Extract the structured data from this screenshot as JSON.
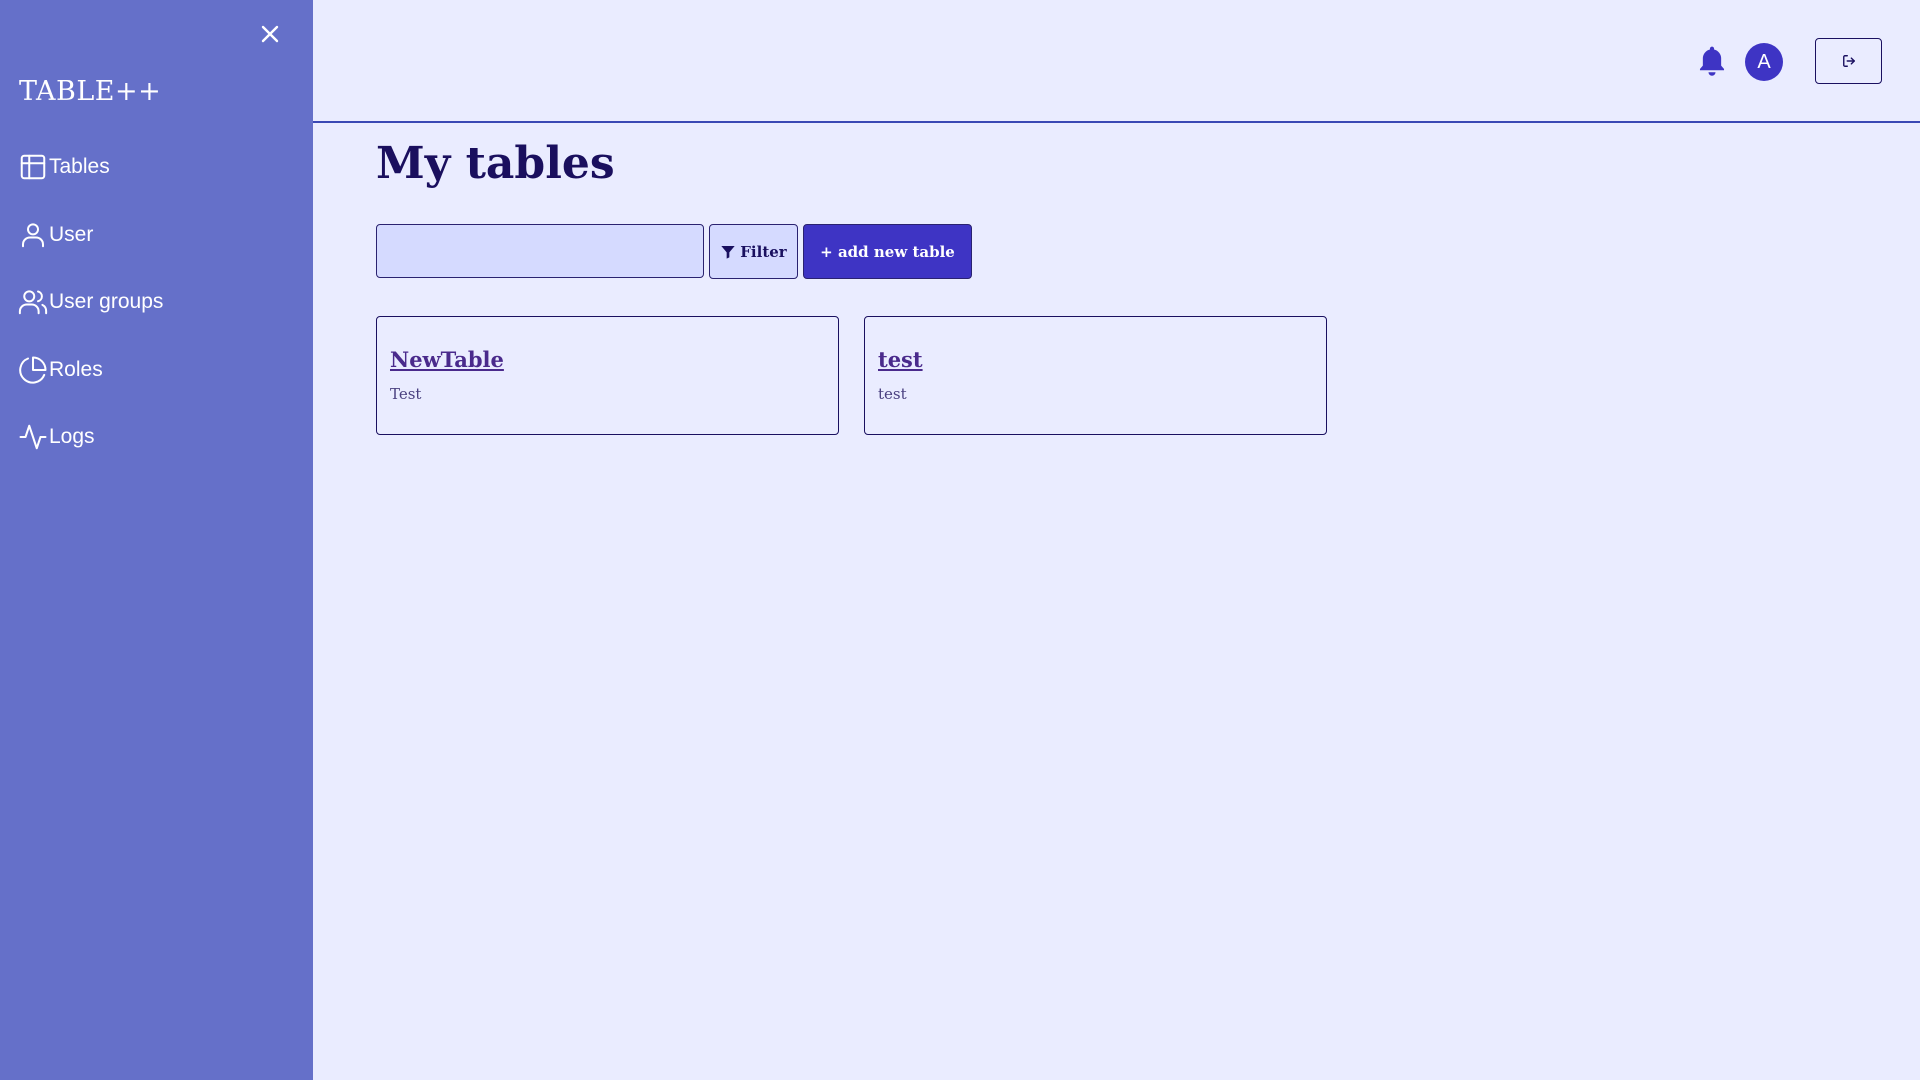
{
  "brand": {
    "name": "TABLE++"
  },
  "sidebar": {
    "close_icon": "close-icon",
    "items": [
      {
        "label": "Tables",
        "icon": "table-icon"
      },
      {
        "label": "User",
        "icon": "user-icon"
      },
      {
        "label": "User groups",
        "icon": "users-icon"
      },
      {
        "label": "Roles",
        "icon": "pie-chart-icon"
      },
      {
        "label": "Logs",
        "icon": "activity-icon"
      }
    ]
  },
  "header": {
    "notification_icon": "bell-icon",
    "avatar_initial": "A",
    "logout_icon": "logout-icon"
  },
  "main": {
    "title": "My tables",
    "search": {
      "value": "",
      "placeholder": ""
    },
    "filter_label": "Filter",
    "filter_icon": "filter-icon",
    "add_label": "+ add new table",
    "tables": [
      {
        "name": "NewTable",
        "description": "Test"
      },
      {
        "name": "test",
        "description": "test"
      }
    ]
  },
  "colors": {
    "background": "#eaecff",
    "sidebar": "#6570c9",
    "primary": "#3e34c4",
    "text_dark": "#1a0f5e",
    "link": "#4a2a8c"
  }
}
